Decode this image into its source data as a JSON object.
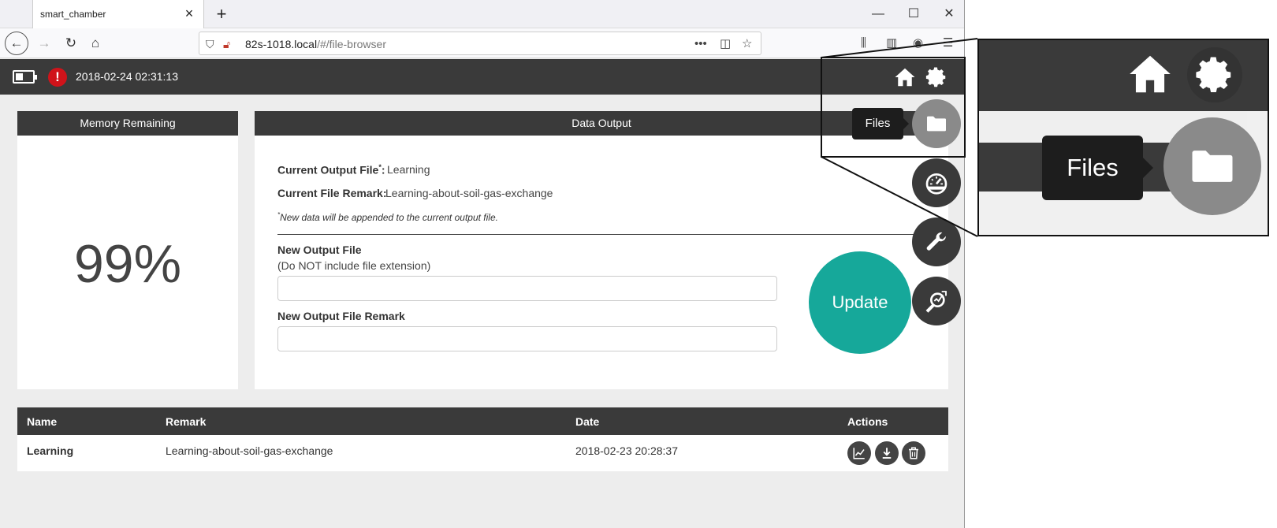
{
  "browser": {
    "tab_title": "smart_chamber",
    "url_host": "82s-1018.local",
    "url_path": "/#/file-browser"
  },
  "header": {
    "timestamp": "2018-02-24 02:31:13",
    "alert_symbol": "!"
  },
  "memory": {
    "title": "Memory Remaining",
    "value": "99%"
  },
  "data_output": {
    "title": "Data Output",
    "current_file_label": "Current Output File",
    "current_file_asterisk": "*",
    "current_file_colon": ":",
    "current_file_value": "Learning",
    "current_remark_label": "Current File Remark:",
    "current_remark_value": "Learning-about-soil-gas-exchange",
    "note_asterisk": "*",
    "note": "New data will be appended to the current output file.",
    "new_file_label": "New Output File",
    "new_file_hint": "(Do NOT include file extension)",
    "new_file_value": "",
    "new_remark_label": "New Output File Remark",
    "new_remark_value": "",
    "update_label": "Update"
  },
  "side_nav": {
    "tooltip": "Files",
    "items": [
      "folder-icon",
      "dashboard-icon",
      "wrench-icon",
      "search-analysis-icon"
    ],
    "active": "folder-icon"
  },
  "table": {
    "headers": [
      "Name",
      "Remark",
      "Date",
      "Actions"
    ],
    "rows": [
      {
        "name": "Learning",
        "remark": "Learning-about-soil-gas-exchange",
        "date": "2018-02-23 20:28:37",
        "actions": [
          "chart-icon",
          "download-icon",
          "trash-icon"
        ]
      }
    ]
  },
  "zoom_inset": {
    "tooltip": "Files"
  },
  "colors": {
    "header_bg": "#3a3a3a",
    "accent_teal": "#16a89a",
    "alert_red": "#d0131a",
    "active_fab": "#8a8a8a"
  }
}
